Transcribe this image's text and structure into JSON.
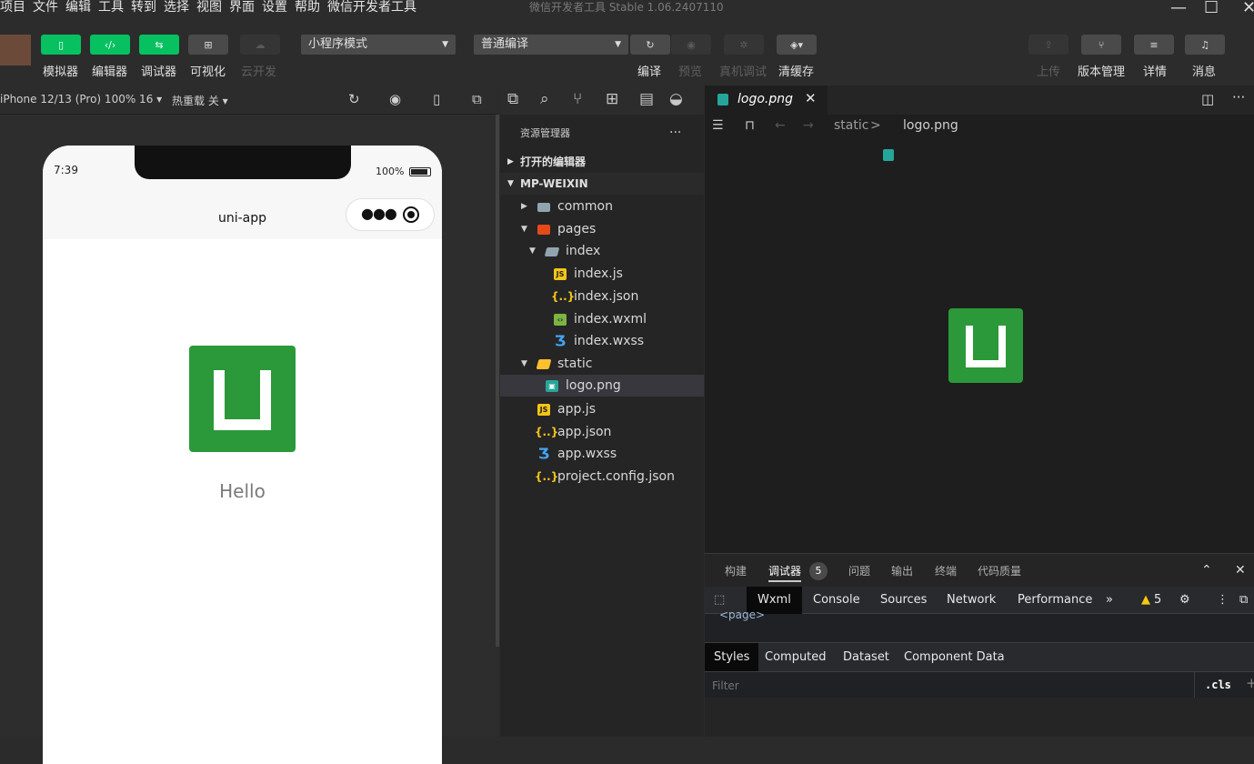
{
  "menu": {
    "items": [
      "项目",
      "文件",
      "编辑",
      "工具",
      "转到",
      "选择",
      "视图",
      "界面",
      "设置",
      "帮助",
      "微信开发者工具"
    ],
    "window_title": "微信开发者工具 Stable 1.06.2407110"
  },
  "toolbar": {
    "simulator": "模拟器",
    "editor": "编辑器",
    "debugger": "调试器",
    "visual": "可视化",
    "cloud": "云开发",
    "mode_select": "小程序模式",
    "compile_select": "普通编译",
    "compile": "编译",
    "preview": "预览",
    "device_debug": "真机调试",
    "clear_cache": "清缓存",
    "upload": "上传",
    "version": "版本管理",
    "details": "详情",
    "messages": "消息"
  },
  "simulator": {
    "device": "iPhone 12/13 (Pro) 100% 16 ▾",
    "hot_reload": "热重载 关 ▾",
    "time": "7:39",
    "battery": "100%",
    "nav_title": "uni-app",
    "hello": "Hello"
  },
  "explorer": {
    "title": "资源管理器",
    "more": "...",
    "open_editors": "打开的编辑器",
    "project": "MP-WEIXIN",
    "tree": [
      {
        "label": "common",
        "type": "folder"
      },
      {
        "label": "pages",
        "type": "folder-red"
      },
      {
        "label": "index",
        "type": "folder-open"
      },
      {
        "label": "index.js",
        "type": "js"
      },
      {
        "label": "index.json",
        "type": "json"
      },
      {
        "label": "index.wxml",
        "type": "wxml"
      },
      {
        "label": "index.wxss",
        "type": "wxss"
      },
      {
        "label": "static",
        "type": "folder-y"
      },
      {
        "label": "logo.png",
        "type": "png"
      },
      {
        "label": "app.js",
        "type": "js"
      },
      {
        "label": "app.json",
        "type": "json"
      },
      {
        "label": "app.wxss",
        "type": "wxss"
      },
      {
        "label": "project.config.json",
        "type": "json"
      }
    ]
  },
  "editor": {
    "tab": "logo.png",
    "crumb_folder": "static",
    "crumb_sep": ">",
    "crumb_file": "logo.png"
  },
  "debug": {
    "tabs": [
      "构建",
      "调试器",
      "问题",
      "输出",
      "终端",
      "代码质量"
    ],
    "badge": "5",
    "devtools_tabs": [
      "Wxml",
      "Console",
      "Sources",
      "Network",
      "Performance"
    ],
    "more": "»",
    "warnings": "5",
    "page_node": "<page>",
    "style_tabs": [
      "Styles",
      "Computed",
      "Dataset",
      "Component Data"
    ],
    "filter_placeholder": "Filter",
    "cls": ".cls",
    "plus": "+"
  },
  "colors": {
    "accent_green": "#07c160",
    "logo_green": "#2b9939"
  }
}
